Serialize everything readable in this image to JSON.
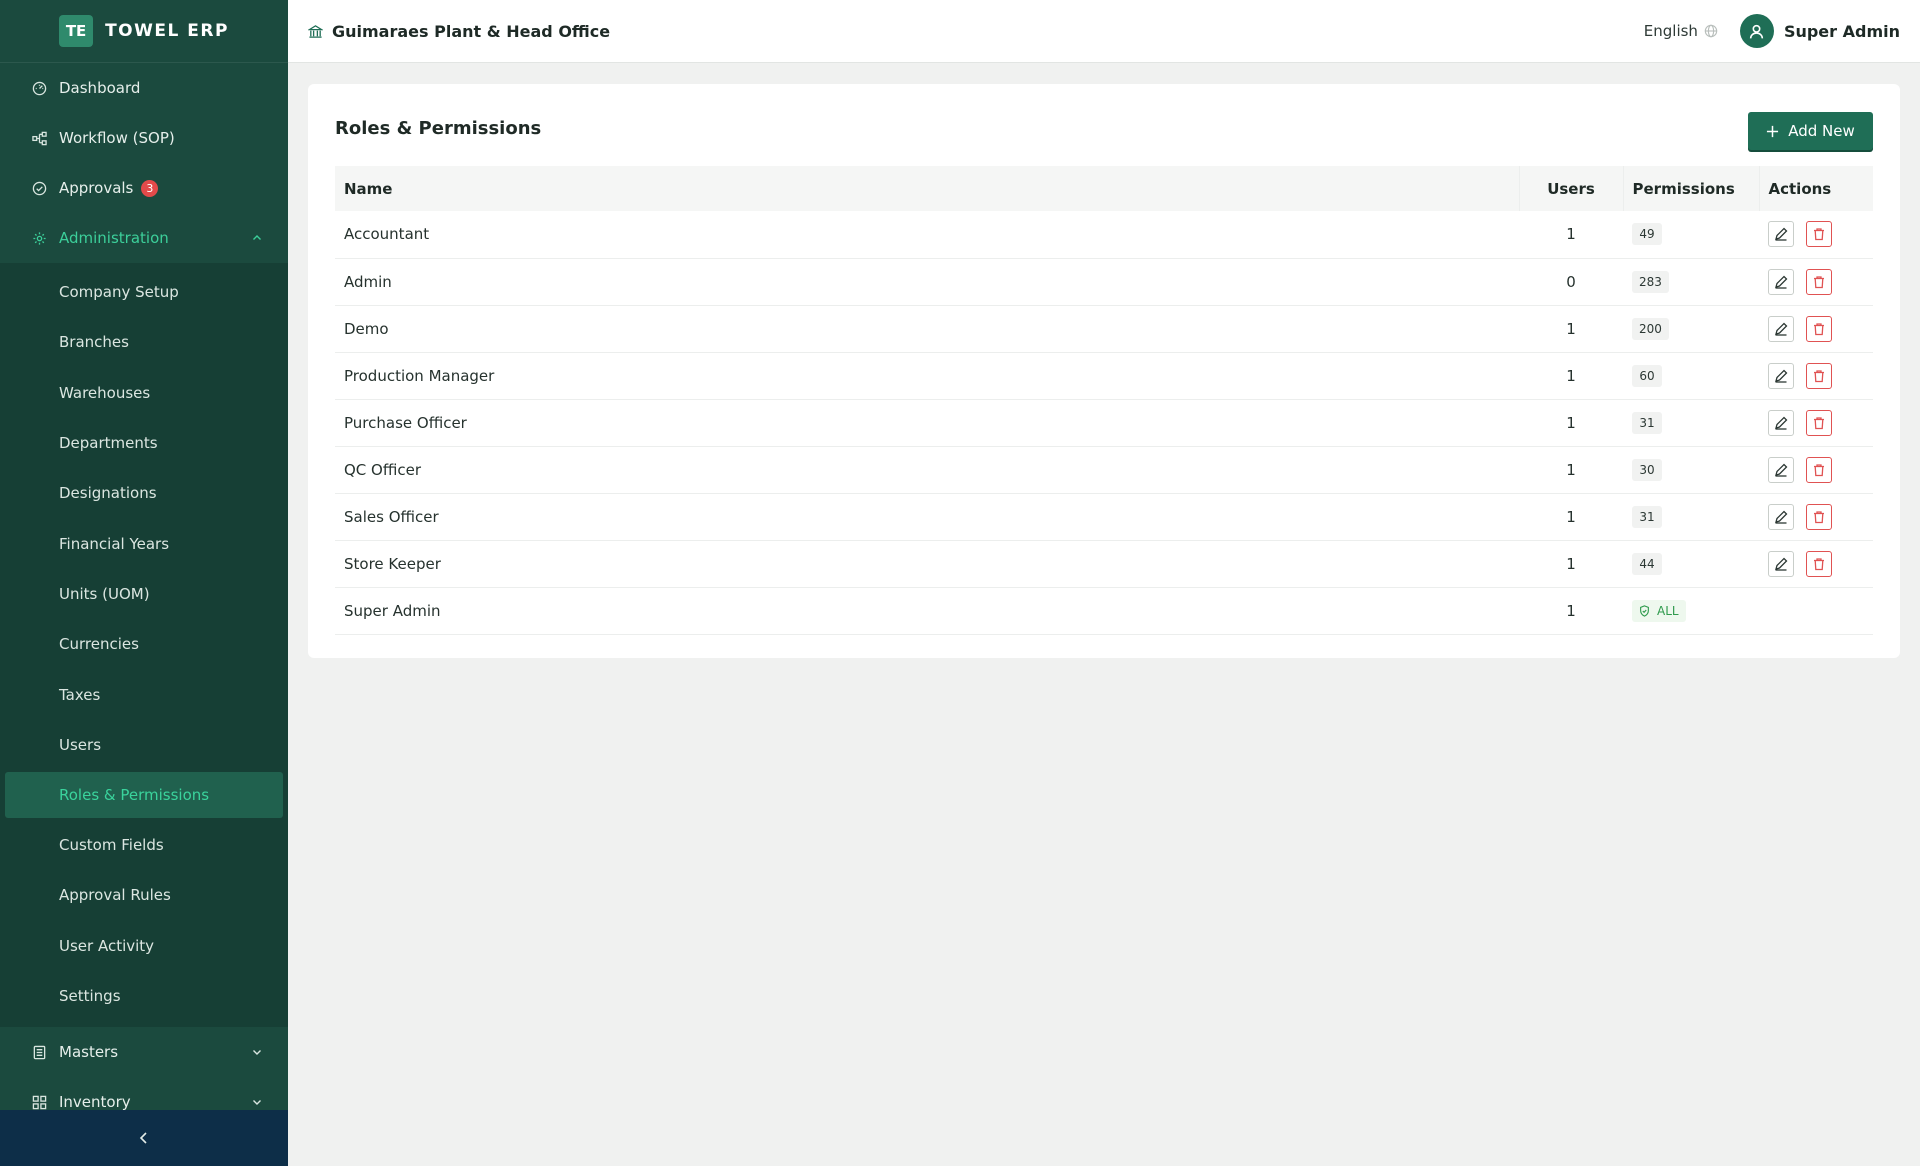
{
  "brand": {
    "logo": "TE",
    "name": "TOWEL ERP"
  },
  "topbar": {
    "branch": "Guimaraes Plant & Head Office",
    "language": "English",
    "user": "Super Admin"
  },
  "sidebar": {
    "items": [
      {
        "label": "Dashboard",
        "icon": "dashboard-icon"
      },
      {
        "label": "Workflow (SOP)",
        "icon": "workflow-icon"
      },
      {
        "label": "Approvals",
        "icon": "check-circle-icon",
        "badge": "3"
      },
      {
        "label": "Administration",
        "icon": "gear-icon"
      }
    ],
    "admin_items": [
      "Company Setup",
      "Branches",
      "Warehouses",
      "Departments",
      "Designations",
      "Financial Years",
      "Units (UOM)",
      "Currencies",
      "Taxes",
      "Users",
      "Roles & Permissions",
      "Custom Fields",
      "Approval Rules",
      "User Activity",
      "Settings"
    ],
    "after_items": [
      {
        "label": "Masters",
        "icon": "list-icon"
      },
      {
        "label": "Inventory",
        "icon": "grid-icon"
      }
    ]
  },
  "main": {
    "title": "Roles & Permissions",
    "add_label": "Add New",
    "columns": {
      "name": "Name",
      "users": "Users",
      "permissions": "Permissions",
      "actions": "Actions"
    },
    "rows": [
      {
        "name": "Accountant",
        "users": "1",
        "permissions": "49"
      },
      {
        "name": "Admin",
        "users": "0",
        "permissions": "283"
      },
      {
        "name": "Demo",
        "users": "1",
        "permissions": "200"
      },
      {
        "name": "Production Manager",
        "users": "1",
        "permissions": "60"
      },
      {
        "name": "Purchase Officer",
        "users": "1",
        "permissions": "31"
      },
      {
        "name": "QC Officer",
        "users": "1",
        "permissions": "30"
      },
      {
        "name": "Sales Officer",
        "users": "1",
        "permissions": "31"
      },
      {
        "name": "Store Keeper",
        "users": "1",
        "permissions": "44"
      },
      {
        "name": "Super Admin",
        "users": "1",
        "permissions": "ALL"
      }
    ]
  },
  "colors": {
    "sidebar_bg": "#1b4a3e",
    "accent": "#1f6e56",
    "active_text": "#3ad39c",
    "danger": "#e05252"
  }
}
